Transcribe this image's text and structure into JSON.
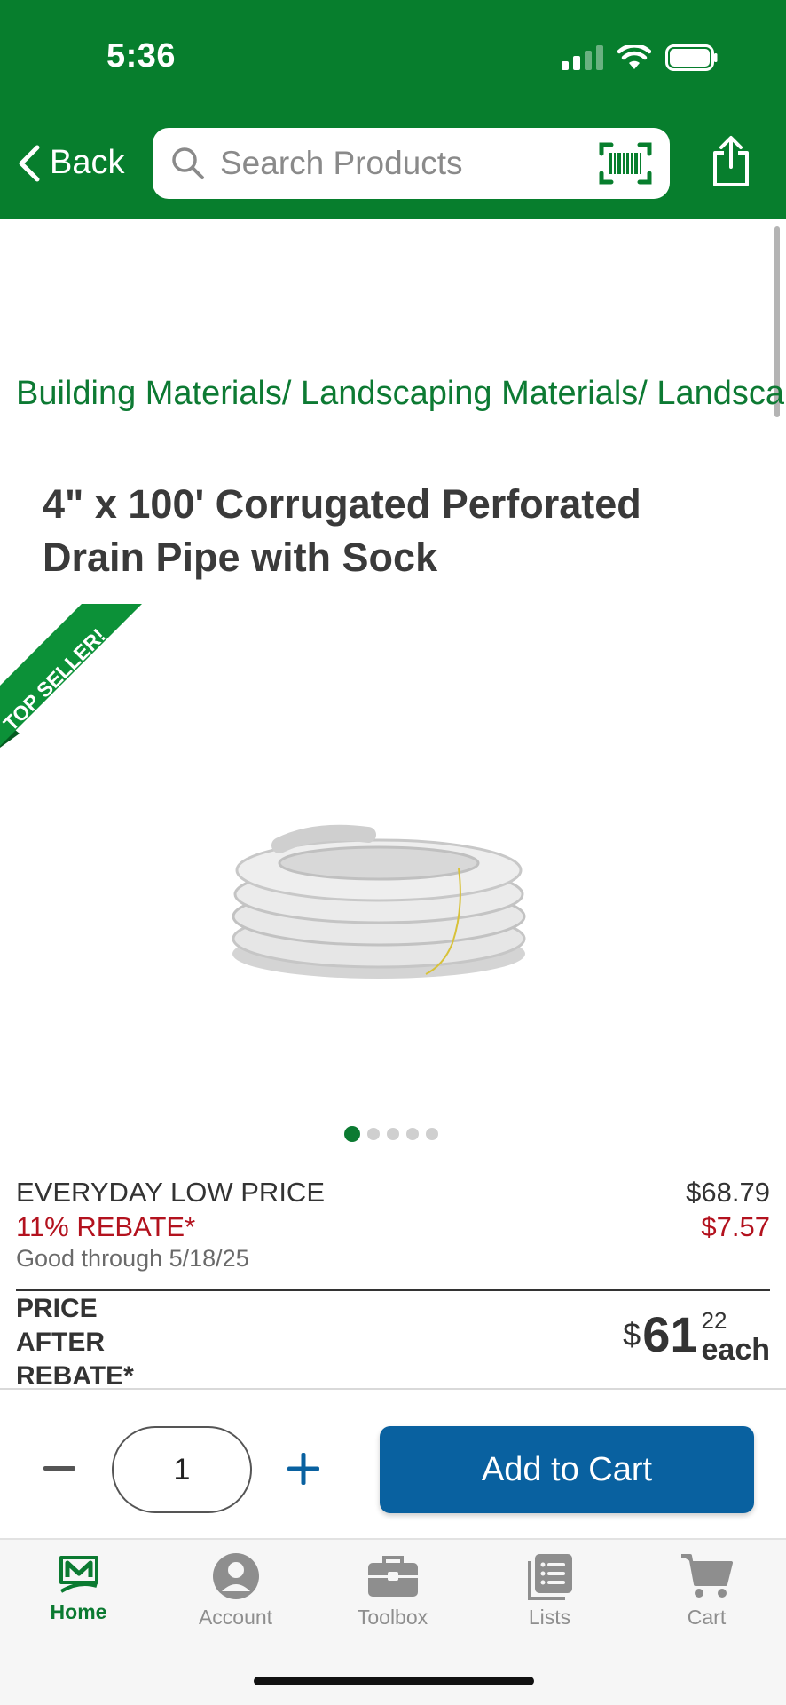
{
  "status_bar": {
    "time": "5:36"
  },
  "header": {
    "back_label": "Back",
    "search_placeholder": "Search Products"
  },
  "breadcrumb": "Building Materials/ Landscaping Materials/ Landscaping",
  "product": {
    "title": "4\" x 100' Corrugated Perforated Drain Pipe with Sock",
    "badge": "TOP SELLER!",
    "image_count": 5,
    "active_image": 1
  },
  "pricing": {
    "everyday_label": "EVERYDAY LOW PRICE",
    "everyday_value": "$68.79",
    "rebate_label": "11% REBATE*",
    "rebate_value": "$7.57",
    "good_through": "Good through 5/18/25",
    "after_rebate_label": "PRICE AFTER REBATE*",
    "final_currency": "$",
    "final_dollars": "61",
    "final_cents": "22",
    "final_unit": "each"
  },
  "cart": {
    "quantity": "1",
    "add_label": "Add to Cart"
  },
  "nav": {
    "items": [
      {
        "label": "Home",
        "icon": "home-logo-icon",
        "active": true
      },
      {
        "label": "Account",
        "icon": "account-icon",
        "active": false
      },
      {
        "label": "Toolbox",
        "icon": "toolbox-icon",
        "active": false
      },
      {
        "label": "Lists",
        "icon": "lists-icon",
        "active": false
      },
      {
        "label": "Cart",
        "icon": "cart-icon",
        "active": false
      }
    ]
  },
  "colors": {
    "brand_green": "#077e2d",
    "rebate_red": "#b3121e",
    "cta_blue": "#0961a0"
  }
}
